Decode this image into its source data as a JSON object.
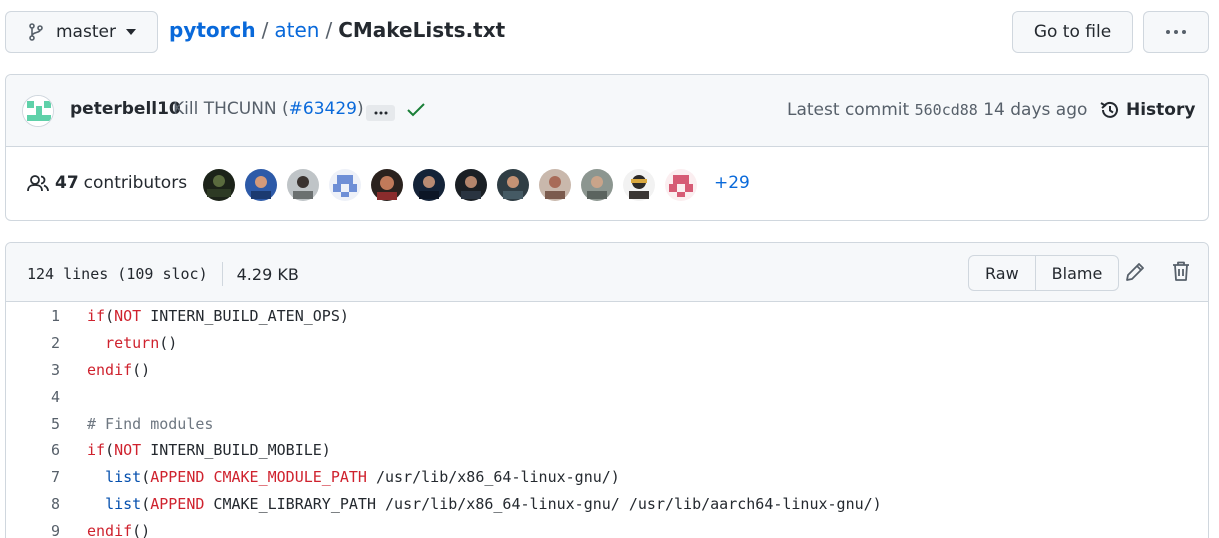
{
  "branch": {
    "name": "master"
  },
  "breadcrumb": {
    "repo": "pytorch",
    "sep1": "/",
    "dir": "aten",
    "sep2": "/",
    "file": "CMakeLists.txt"
  },
  "actions": {
    "go_to_file": "Go to file"
  },
  "commit": {
    "author": "peterbell10",
    "message_prefix": "Kill THCUNN (",
    "pr": "#63429",
    "message_suffix": ")",
    "latest_label": "Latest commit",
    "sha": "560cd88",
    "age": "14 days ago",
    "history": "History",
    "status_color": "#1a7f37"
  },
  "contributors": {
    "count": "47",
    "label": "contributors",
    "more": "+29",
    "avatars": [
      "contributor-1",
      "contributor-2",
      "contributor-3",
      "contributor-4",
      "contributor-5",
      "contributor-6",
      "contributor-7",
      "contributor-8",
      "contributor-9",
      "contributor-10",
      "contributor-11",
      "contributor-12"
    ]
  },
  "file": {
    "lines": "124 lines (109 sloc)",
    "size": "4.29 KB",
    "raw": "Raw",
    "blame": "Blame"
  },
  "code": [
    {
      "n": "1",
      "parts": [
        [
          "kw",
          "if"
        ],
        [
          "",
          "("
        ],
        [
          "kw",
          "NOT"
        ],
        [
          "",
          " INTERN_BUILD_ATEN_OPS)"
        ]
      ]
    },
    {
      "n": "2",
      "parts": [
        [
          "",
          "  "
        ],
        [
          "kw",
          "return"
        ],
        [
          "",
          "()"
        ]
      ]
    },
    {
      "n": "3",
      "parts": [
        [
          "kw",
          "endif"
        ],
        [
          "",
          "()"
        ]
      ]
    },
    {
      "n": "4",
      "parts": []
    },
    {
      "n": "5",
      "parts": [
        [
          "cm",
          "# Find modules"
        ]
      ]
    },
    {
      "n": "6",
      "parts": [
        [
          "kw",
          "if"
        ],
        [
          "",
          "("
        ],
        [
          "kw",
          "NOT"
        ],
        [
          "",
          " INTERN_BUILD_MOBILE)"
        ]
      ]
    },
    {
      "n": "7",
      "parts": [
        [
          "",
          "  "
        ],
        [
          "bl",
          "list"
        ],
        [
          "",
          "("
        ],
        [
          "kw",
          "APPEND"
        ],
        [
          "",
          " "
        ],
        [
          "kw",
          "CMAKE_MODULE_PATH"
        ],
        [
          "",
          " /usr/lib/x86_64-linux-gnu/)"
        ]
      ]
    },
    {
      "n": "8",
      "parts": [
        [
          "",
          "  "
        ],
        [
          "bl",
          "list"
        ],
        [
          "",
          "("
        ],
        [
          "kw",
          "APPEND"
        ],
        [
          "",
          " CMAKE_LIBRARY_PATH /usr/lib/x86_64-linux-gnu/ /usr/lib/aarch64-linux-gnu/)"
        ]
      ]
    },
    {
      "n": "9",
      "parts": [
        [
          "kw",
          "endif"
        ],
        [
          "",
          "()"
        ]
      ]
    }
  ]
}
